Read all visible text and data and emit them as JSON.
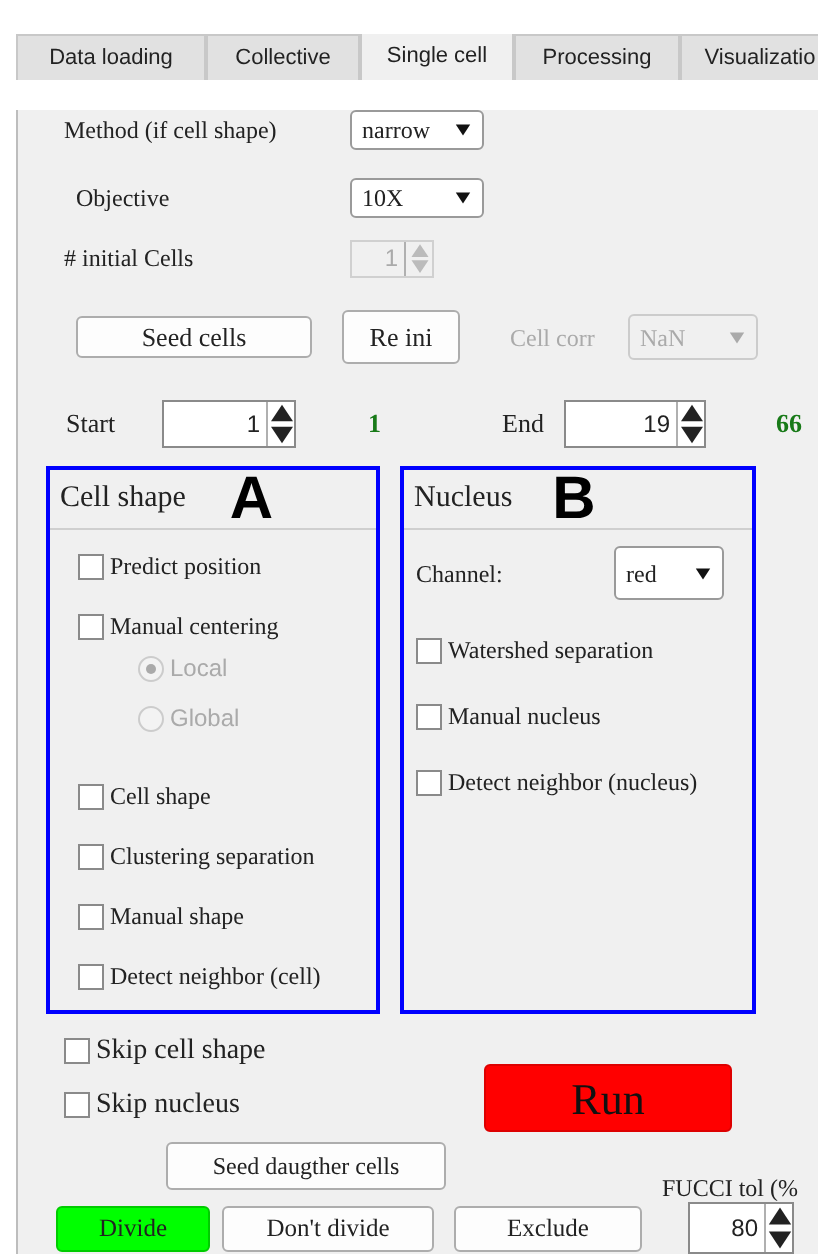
{
  "tabs": [
    {
      "label": "Data loading",
      "selected": false
    },
    {
      "label": "Collective",
      "selected": false
    },
    {
      "label": "Single cell",
      "selected": true
    },
    {
      "label": "Processing",
      "selected": false
    },
    {
      "label": "Visualizatio",
      "selected": false
    }
  ],
  "method": {
    "label": "Method (if cell shape)",
    "value": "narrow"
  },
  "objective": {
    "label": "Objective",
    "value": "10X"
  },
  "initial_cells": {
    "label": "# initial Cells",
    "value": "1",
    "disabled": true
  },
  "seed_cells_button": "Seed cells",
  "reinit_button": "Re ini",
  "cell_corr": {
    "label": "Cell corr",
    "value": "NaN",
    "disabled": true
  },
  "start": {
    "label": "Start",
    "value": "1",
    "reading": "1"
  },
  "end": {
    "label": "End",
    "value": "19",
    "reading": "66"
  },
  "panels": [
    {
      "title": "Cell shape",
      "annotation": "A",
      "items": [
        {
          "kind": "checkbox",
          "label": "Predict position",
          "checked": false
        },
        {
          "kind": "checkbox",
          "label": "Manual centering",
          "checked": false
        },
        {
          "kind": "radio",
          "label": "Local",
          "selected": true,
          "disabled": true
        },
        {
          "kind": "radio",
          "label": "Global",
          "selected": false,
          "disabled": true
        },
        {
          "kind": "checkbox",
          "label": "Cell shape",
          "checked": false
        },
        {
          "kind": "checkbox",
          "label": "Clustering separation",
          "checked": false
        },
        {
          "kind": "checkbox",
          "label": "Manual shape",
          "checked": false
        },
        {
          "kind": "checkbox",
          "label": "Detect neighbor (cell)",
          "checked": false
        }
      ]
    },
    {
      "title": "Nucleus",
      "annotation": "B",
      "items": [
        {
          "kind": "dropdown",
          "label": "Channel:",
          "value": "red"
        },
        {
          "kind": "checkbox",
          "label": "Watershed separation",
          "checked": false
        },
        {
          "kind": "checkbox",
          "label": "Manual nucleus",
          "checked": false
        },
        {
          "kind": "checkbox",
          "label": "Detect neighbor (nucleus)",
          "checked": false
        }
      ]
    }
  ],
  "skip_options": [
    {
      "label": "Skip cell shape",
      "checked": false
    },
    {
      "label": "Skip nucleus",
      "checked": false
    }
  ],
  "run_button": "Run",
  "seed_daughter_button": "Seed daugther cells",
  "actions": [
    {
      "label": "Divide",
      "selected": true
    },
    {
      "label": "Don't divide",
      "selected": false
    },
    {
      "label": "Exclude",
      "selected": false
    }
  ],
  "fucci_tol": {
    "label": "FUCCI tol (%",
    "value": "80"
  }
}
